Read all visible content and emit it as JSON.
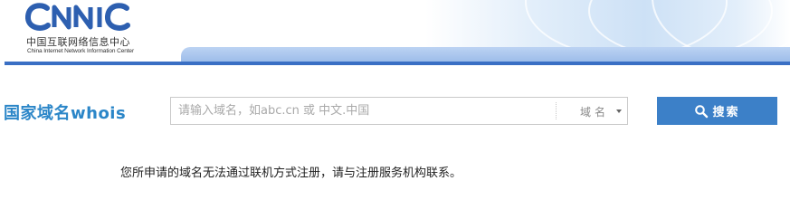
{
  "header": {
    "logo": {
      "mark": "CNNIC",
      "name_cn": "中国互联网络信息中心",
      "name_en": "China Internet Network Information Center"
    }
  },
  "search": {
    "heading": "国家域名whois",
    "placeholder": "请输入域名，如abc.cn 或 中文.中国",
    "value": "",
    "type_selected": "域名",
    "button_label": "搜索",
    "button_icon": "search-icon",
    "accent_color": "#3c80c8"
  },
  "result": {
    "message": "您所申请的域名无法通过联机方式注册，请与注册服务机构联系。"
  }
}
